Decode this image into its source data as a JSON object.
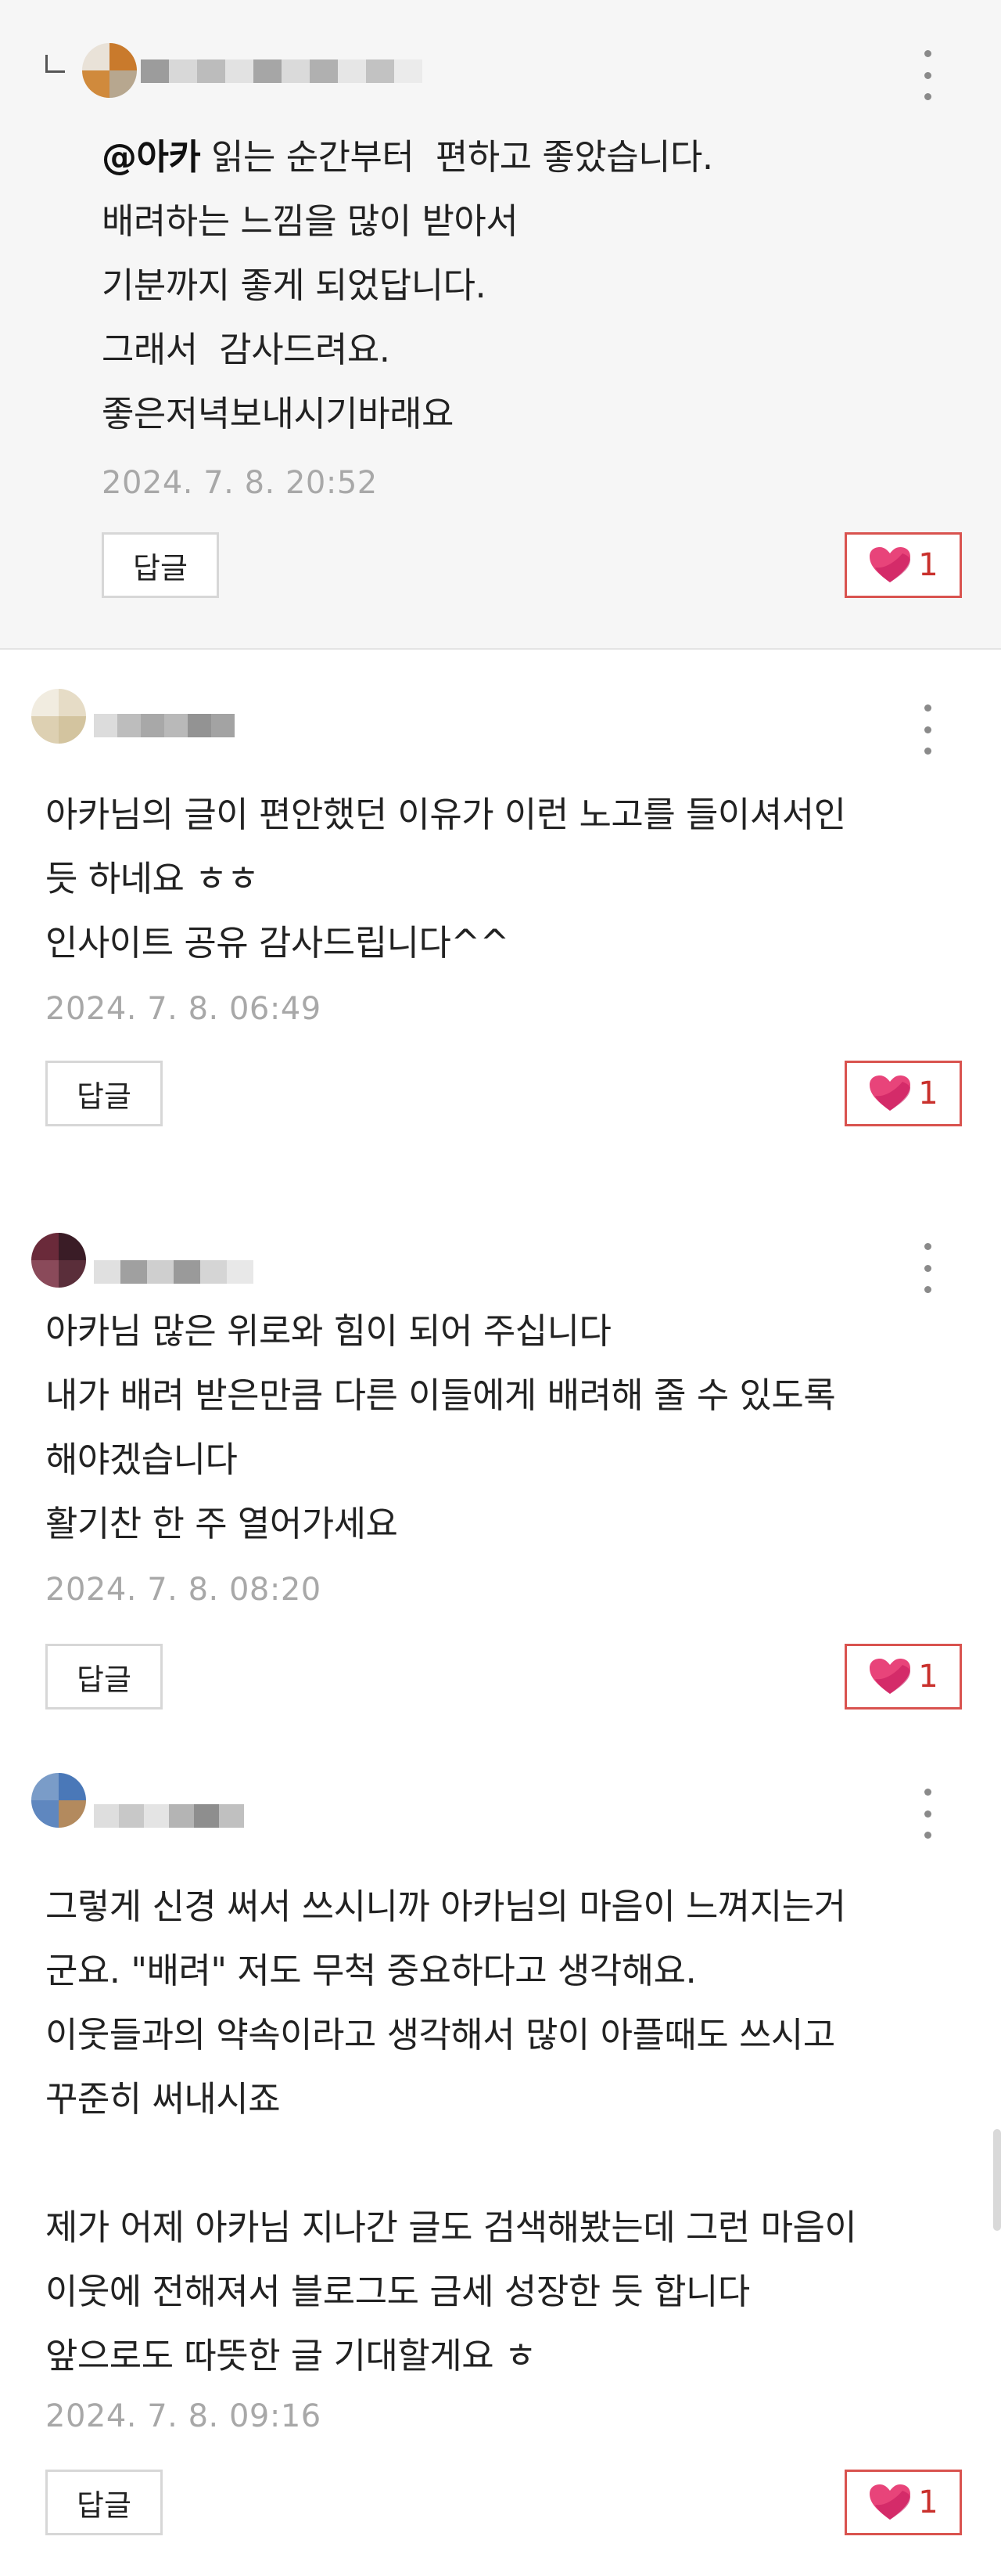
{
  "comments": [
    {
      "id": "reply-1",
      "is_reply": true,
      "mention": "@아카",
      "lines": [
        " 읽는 순간부터  편하고 좋았습니다.",
        "배려하는 느낌을 많이 받아서",
        "기분까지 좋게 되었답니다.",
        "그래서  감사드려요.",
        "좋은저녁보내시기바래요"
      ],
      "timestamp": "2024. 7. 8. 20:52",
      "reply_label": "답글",
      "like_count": "1"
    },
    {
      "id": "comment-2",
      "is_reply": false,
      "lines": [
        "아카님의 글이 편안했던 이유가 이런 노고를 들이셔서인",
        "듯 하네요 ㅎㅎ",
        "인사이트 공유 감사드립니다^^"
      ],
      "timestamp": "2024. 7. 8. 06:49",
      "reply_label": "답글",
      "like_count": "1"
    },
    {
      "id": "comment-3",
      "is_reply": false,
      "lines": [
        "아카님 많은 위로와 힘이 되어 주십니다",
        "내가 배려 받은만큼 다른 이들에게 배려해 줄 수 있도록",
        "해야겠습니다",
        "활기찬 한 주 열어가세요"
      ],
      "timestamp": "2024. 7. 8. 08:20",
      "reply_label": "답글",
      "like_count": "1"
    },
    {
      "id": "comment-4",
      "is_reply": false,
      "lines": [
        "그렇게 신경 써서 쓰시니까 아카님의 마음이 느껴지는거",
        "군요. \"배려\" 저도 무척 중요하다고 생각해요.",
        "이웃들과의 약속이라고 생각해서 많이 아플때도 쓰시고",
        "꾸준히 써내시죠",
        "",
        "제가 어제 아카님 지나간 글도 검색해봤는데 그런 마음이",
        "이웃에 전해져서 블로그도 금세 성장한 듯 합니다",
        "앞으로도 따뜻한 글 기대할게요 ㅎ"
      ],
      "timestamp": "2024. 7. 8. 09:16",
      "reply_label": "답글",
      "like_count": "1"
    }
  ],
  "colors": {
    "like_border": "#d9534f",
    "heart_pink": "#e8447a",
    "heart_dark": "#c2185b",
    "timestamp": "#a8a8a8"
  },
  "icons": {
    "more": "vertical-ellipsis-icon",
    "heart": "heart-icon",
    "reply_indicator": "reply-arrow-icon"
  }
}
